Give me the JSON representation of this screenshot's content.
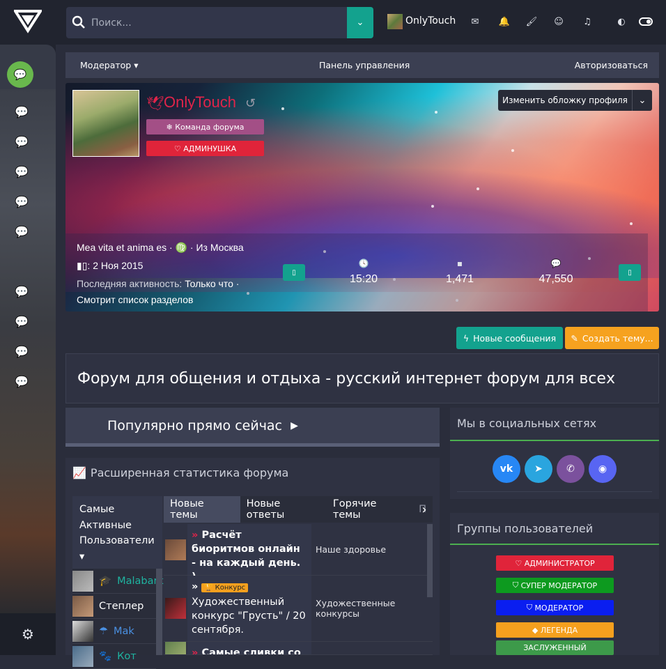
{
  "search": {
    "placeholder": "Поиск..."
  },
  "user": {
    "name": "OnlyTouch"
  },
  "subnav": {
    "moderator": "Модератор",
    "panel": "Панель управления",
    "login": "Авторизоваться"
  },
  "profile": {
    "name": "OnlyTouch",
    "badge_team": "Команда форума",
    "badge_admin": "АДМИНУШКА",
    "edit_cover": "Изменить обложку профиля",
    "line1": "Mea vita et anima es · ♍ · Из Москва",
    "line2": "2 Ноя 2015",
    "line3_label": "Последняя активность:",
    "line3_value": "Только что ·",
    "line4": "Смотрит список разделов",
    "stat_time": "15:20",
    "stat_messages": "1,471",
    "stat_reactions": "47,550"
  },
  "actions": {
    "new_posts": "Новые сообщения",
    "create_topic": "Создать тему..."
  },
  "forum_title": "Форум для общения и отдыха - русский интернет форум для всех",
  "popular": "Популярно прямо сейчас",
  "stats": {
    "title": "Расширенная статистика форума",
    "left_header": "Самые Активные Пользователи",
    "users": [
      {
        "name": "Malabark",
        "color": "#1fb3a0"
      },
      {
        "name": "Степлер",
        "color": "#ffffff"
      },
      {
        "name": "Mak",
        "color": "#4a90e2"
      },
      {
        "name": "Кот",
        "color": "#1fb3a0"
      }
    ],
    "tabs": [
      "Новые темы",
      "Новые ответы",
      "Горячие темы",
      "П"
    ],
    "rows": [
      {
        "prefix": "",
        "topic": "Расчёт биоритмов онлайн - на каждый день. )",
        "forum": "Наше здоровье"
      },
      {
        "prefix": "Конкурс",
        "topic": "Художественный конкурс \"Грусть\" / 20 сентября.",
        "forum": "Художественные конкурсы"
      },
      {
        "prefix": "",
        "topic": "Самые сливки со",
        "forum": ""
      }
    ]
  },
  "social": {
    "title": "Мы в социальных сетях",
    "icons": [
      "vk-icon",
      "telegram-icon",
      "viber-icon",
      "discord-icon"
    ]
  },
  "groups": {
    "title": "Группы пользователей",
    "items": [
      {
        "label": "АДМИНИСТРАТОР",
        "color": "#e0243a"
      },
      {
        "label": "СУПЕР МОДЕРАТОР",
        "color": "#0d9a1f"
      },
      {
        "label": "МОДЕРАТОР",
        "color": "#0a1ef0"
      },
      {
        "label": "ЛЕГЕНДА",
        "color": "#f5a01e"
      },
      {
        "label": "ЗАСЛУЖЕННЫЙ",
        "color": "#3d9a4a"
      }
    ]
  }
}
